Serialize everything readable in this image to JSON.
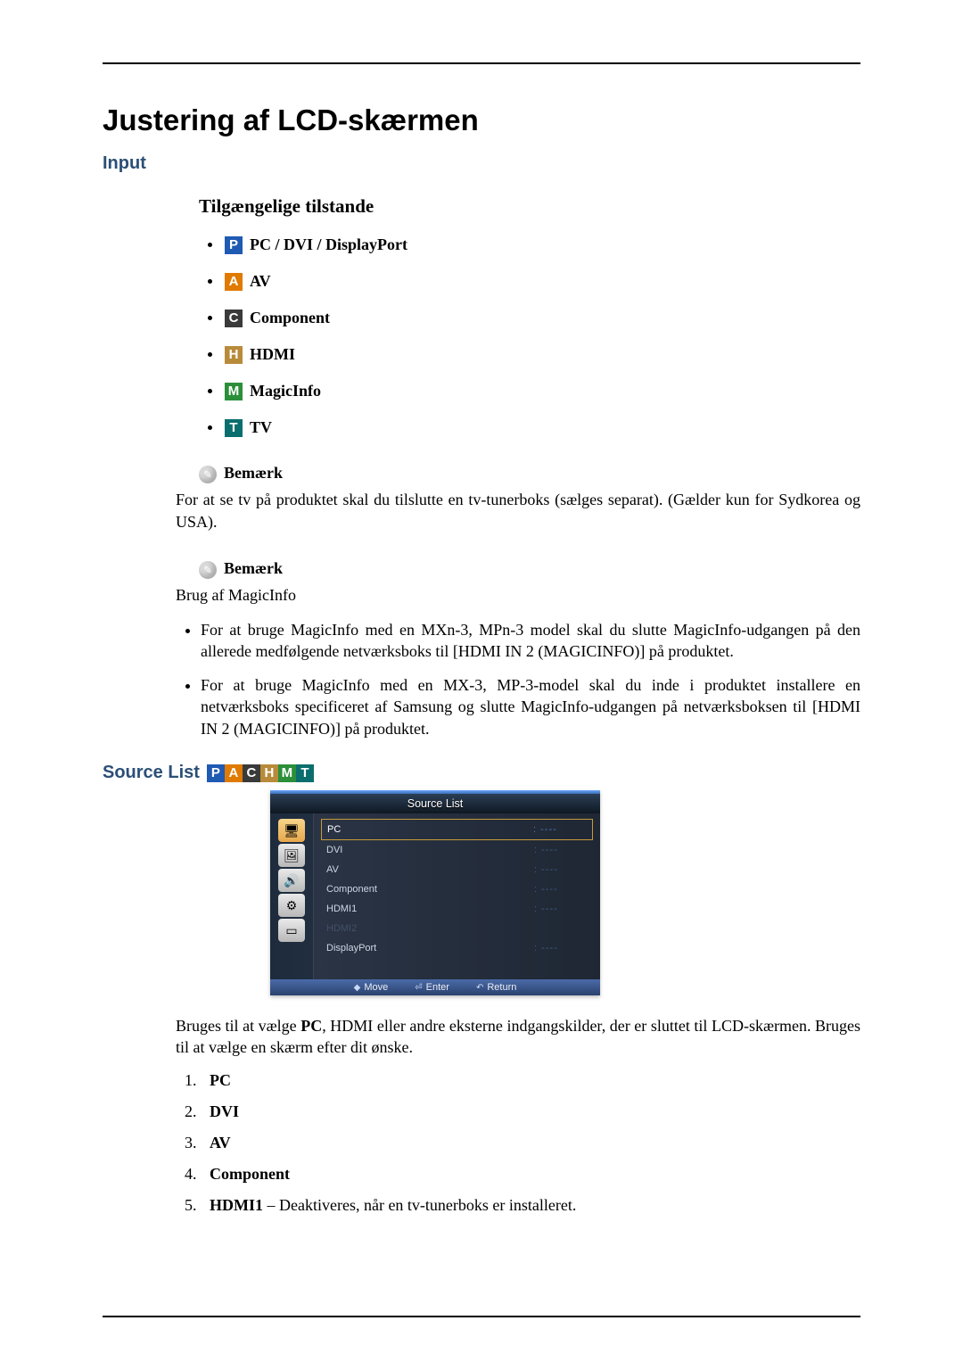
{
  "page_title": "Justering af LCD-skærmen",
  "h2_input": "Input",
  "h3_modes": "Tilgængelige tilstande",
  "modes": {
    "pc": {
      "letter": "P",
      "label": "PC / DVI / DisplayPort"
    },
    "av": {
      "letter": "A",
      "label": "AV"
    },
    "component": {
      "letter": "C",
      "label": "Component"
    },
    "hdmi": {
      "letter": "H",
      "label": "HDMI"
    },
    "magicinfo": {
      "letter": "M",
      "label": "MagicInfo"
    },
    "tv": {
      "letter": "T",
      "label": "TV"
    }
  },
  "note_label": "Bemærk",
  "note1_body": "For at se tv på produktet skal du tilslutte en tv-tunerboks (sælges separat). (Gælder kun for Sydkorea og USA).",
  "note2_intro": "Brug af MagicInfo",
  "note2_items": {
    "a": "For at bruge MagicInfo med en MXn-3, MPn-3 model skal du slutte MagicInfo-udgangen på den allerede medfølgende netværksboks til [HDMI IN 2 (MAGICINFO)] på produktet.",
    "b": "For at bruge MagicInfo med en MX-3, MP-3-model skal du inde i produktet installere en netværksboks specificeret af Samsung og slutte MagicInfo-udgangen på netværksboksen til [HDMI IN 2 (MAGICINFO)] på produktet."
  },
  "source_list_title": "Source List",
  "osd": {
    "title": "Source List",
    "rows": [
      {
        "label": "PC",
        "value": ": ----",
        "sel": true
      },
      {
        "label": "DVI",
        "value": ": ----"
      },
      {
        "label": "AV",
        "value": ": ----"
      },
      {
        "label": "Component",
        "value": ": ----"
      },
      {
        "label": "HDMI1",
        "value": ": ----"
      },
      {
        "label": "HDMI2",
        "value": "",
        "dim": true
      },
      {
        "label": "DisplayPort",
        "value": ": ----"
      }
    ],
    "footer": {
      "move": "Move",
      "enter": "Enter",
      "ret": "Return"
    }
  },
  "source_desc_part1": "Bruges til at vælge ",
  "source_desc_bold": "PC",
  "source_desc_part2": ", HDMI eller andre eksterne indgangskilder, der er sluttet til LCD-skærmen. Bruges til at vælge en skærm efter dit ønske.",
  "source_items": {
    "i1": "PC",
    "i2": "DVI",
    "i3": "AV",
    "i4": "Component",
    "i5_label": "HDMI1",
    "i5_extra": " – Deaktiveres, når en tv-tunerboks er installeret."
  }
}
